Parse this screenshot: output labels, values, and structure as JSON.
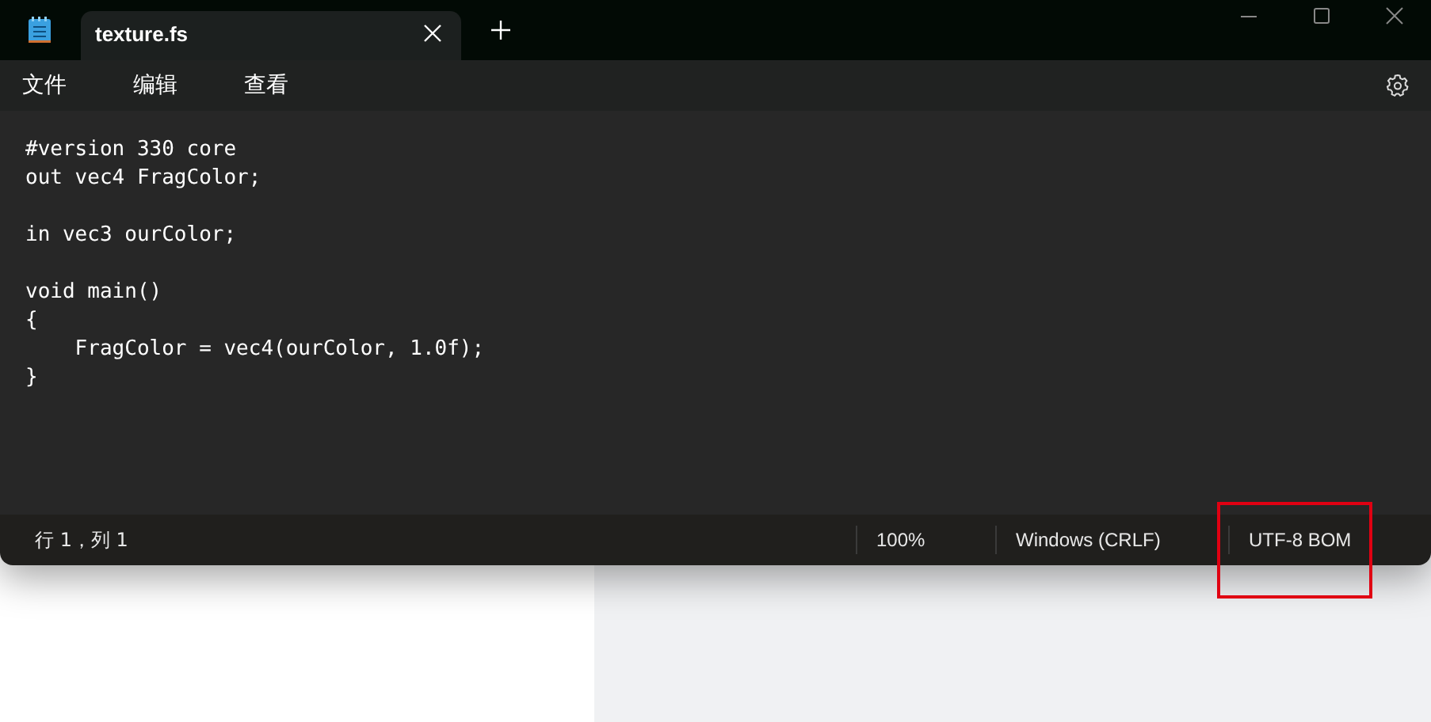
{
  "tabs": [
    {
      "label": "texture.fs",
      "selected": true
    }
  ],
  "menu": [
    "文件",
    "编辑",
    "查看"
  ],
  "editor": {
    "text": "#version 330 core\nout vec4 FragColor;\n\nin vec3 ourColor;\n\nvoid main()\n{\n    FragColor = vec4(ourColor, 1.0f);\n}"
  },
  "status_bar": {
    "position": "行 1，列 1",
    "zoom": "100%",
    "line_ending": "Windows (CRLF)",
    "encoding": "UTF-8 BOM"
  },
  "annotation": {
    "kind": "rectangle",
    "color": "#e00012"
  }
}
